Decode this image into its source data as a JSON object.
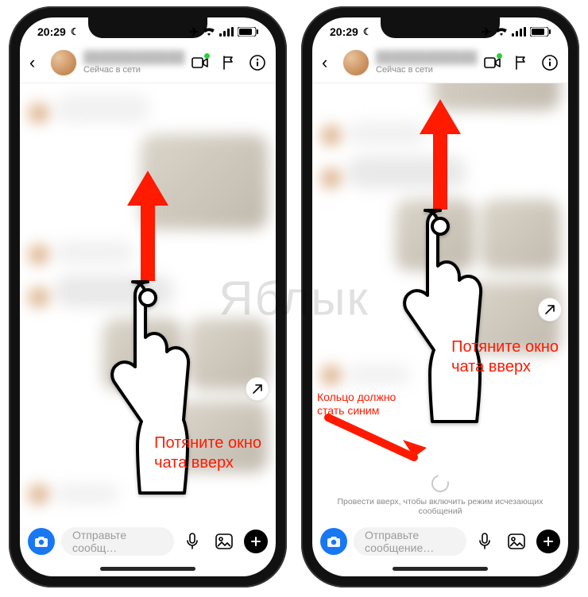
{
  "status": {
    "time": "20:29",
    "dnd_icon": "moon-icon",
    "indicators": [
      "airplane-icon",
      "wifi-icon",
      "signal-icon",
      "battery-icon"
    ]
  },
  "chat_header": {
    "back_icon": "chevron-left-icon",
    "username_blurred": "████████████",
    "presence": "Сейчас в сети",
    "actions": {
      "video_icon": "video-icon",
      "flag_icon": "flag-icon",
      "info_icon": "info-icon"
    }
  },
  "annotations": {
    "left": {
      "main_caption": "Потяните окно\nчата вверх"
    },
    "right": {
      "main_caption": "Потяните окно\nчата вверх",
      "ring_caption": "Кольцо должно\nстать синим"
    }
  },
  "vanishing_hint": "Провести вверх, чтобы включить режим исчезающих сообщений",
  "composer": {
    "camera_icon": "camera-icon",
    "placeholder_left": "Отправьте сообщ…",
    "placeholder_right": "Отправьте сообщение…",
    "mic_icon": "mic-icon",
    "gallery_icon": "gallery-icon",
    "sticker_icon": "plus-icon"
  },
  "watermark": "Яблык"
}
